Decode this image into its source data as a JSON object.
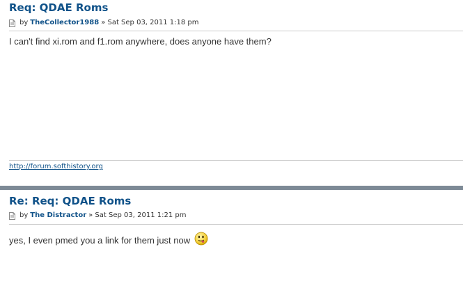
{
  "posts": [
    {
      "title": "Req: QDAE Roms",
      "by_label": "by",
      "author": "TheCollector1988",
      "date": "» Sat Sep 03, 2011 1:18 pm",
      "content": "I can't find xi.rom and f1.rom anywhere, does anyone have them?",
      "signature_link": "http://forum.softhistory.org"
    },
    {
      "title": "Re: Req: QDAE Roms",
      "by_label": "by",
      "author": "The Distractor",
      "date": "» Sat Sep 03, 2011 1:21 pm",
      "content": "yes, I even pmed you a link for them just now",
      "smiley": "tongue-smiley-icon"
    }
  ],
  "colors": {
    "link": "#105289",
    "divider": "#7d8a96",
    "rule": "#cccccc"
  }
}
